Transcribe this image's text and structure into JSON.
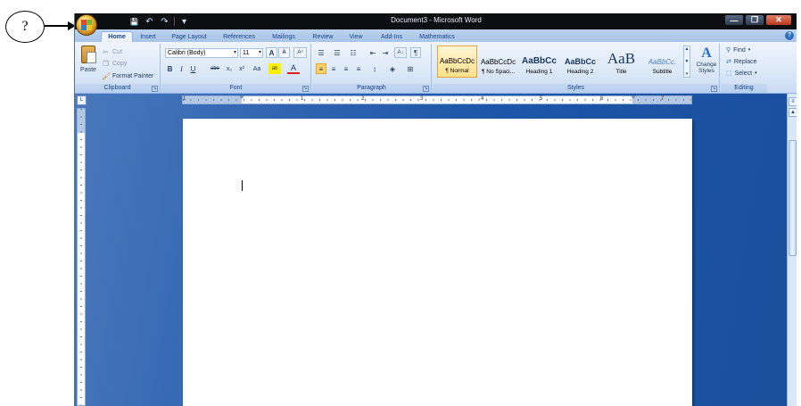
{
  "callout": {
    "label": "?"
  },
  "window": {
    "title": "Document3 - Microsoft Word"
  },
  "quick_access": {
    "save": "💾",
    "undo": "↶",
    "redo": "↷",
    "customize": "▾"
  },
  "window_controls": {
    "minimize": "—",
    "maximize": "❐",
    "close": "✕"
  },
  "tabs": [
    "Home",
    "Insert",
    "Page Layout",
    "References",
    "Mailings",
    "Review",
    "View",
    "Add-Ins",
    "Mathematics"
  ],
  "help": "?",
  "clipboard": {
    "paste": "Paste",
    "cut": "Cut",
    "copy": "Copy",
    "format_painter": "Format Painter",
    "label": "Clipboard"
  },
  "font": {
    "name": "Calibri (Body)",
    "size": "11",
    "grow": "A",
    "shrink": "A",
    "clear": "Aᵒ",
    "bold": "B",
    "italic": "I",
    "underline": "U",
    "strike": "abe",
    "subscript": "x₂",
    "superscript": "x²",
    "change_case": "Aa",
    "highlight": "ab",
    "font_color": "A",
    "label": "Font"
  },
  "paragraph": {
    "sort": "A↓",
    "pilcrow": "¶",
    "label": "Paragraph"
  },
  "styles": {
    "label": "Styles",
    "items": [
      {
        "sample": "AaBbCcDc",
        "name": "¶ Normal"
      },
      {
        "sample": "AaBbCcDc",
        "name": "¶ No Spaci..."
      },
      {
        "sample": "AaBbCc",
        "name": "Heading 1"
      },
      {
        "sample": "AaBbCc",
        "name": "Heading 2"
      },
      {
        "sample": "AaB",
        "name": "Title"
      },
      {
        "sample": "AaBbCc.",
        "name": "Subtitle"
      }
    ],
    "change_styles": "Change Styles",
    "change_styles_icon": "A"
  },
  "editing": {
    "find": "Find",
    "replace": "Replace",
    "select": "Select",
    "label": "Editing"
  },
  "ruler": {
    "numbers": [
      "1",
      "1",
      "2",
      "3",
      "4",
      "5",
      "6",
      "7"
    ]
  },
  "colors": {
    "accent": "#15428b",
    "workspace": "#1d56a8",
    "titlebar": "#0d0f12"
  }
}
